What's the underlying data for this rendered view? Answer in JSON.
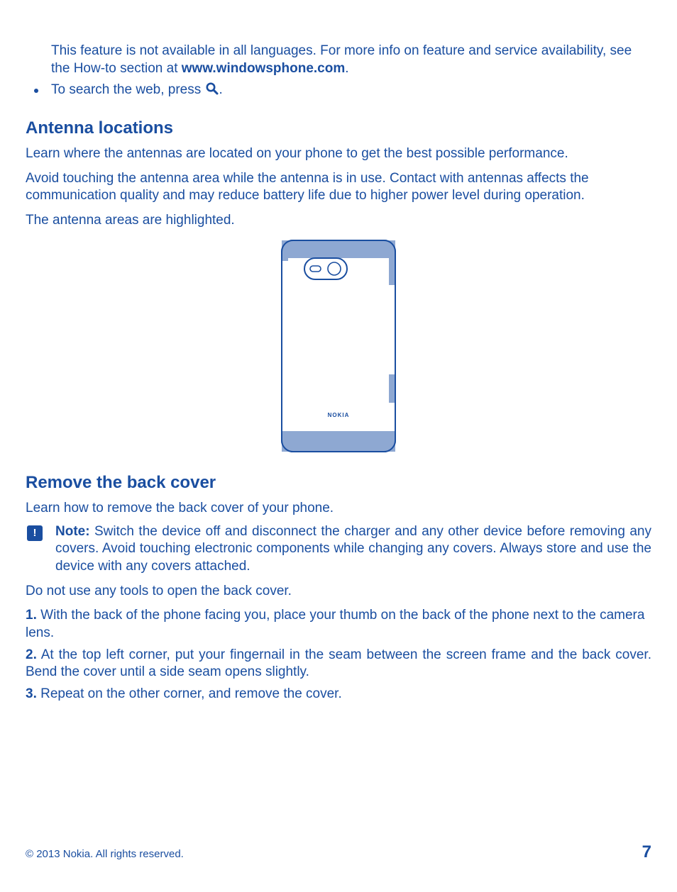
{
  "intro": {
    "p1a": "This feature is not available in all languages. For more info on feature and service availability, see the How-to section at ",
    "p1b_bold": "www.windowsphone.com",
    "p1c": ".",
    "bullet_a": "To search the web, press ",
    "bullet_c": "."
  },
  "antenna": {
    "heading": "Antenna locations",
    "p1": "Learn where the antennas are located on your phone to get the best possible performance.",
    "p2": "Avoid touching the antenna area while the antenna is in use. Contact with antennas affects the communication quality and may reduce battery life due to higher power level during operation.",
    "p3": "The antenna areas are highlighted.",
    "phone_brand": "NOKIA"
  },
  "backcover": {
    "heading": "Remove the back cover",
    "p1": "Learn how to remove the back cover of your phone.",
    "note_label": "Note:",
    "note_text": " Switch the device off and disconnect the charger and any other device before removing any covers. Avoid touching electronic components while changing any covers. Always store and use the device with any covers attached.",
    "p2": "Do not use any tools to open the back cover.",
    "step1_num": "1.",
    "step1_text": " With the back of the phone facing you, place your thumb on the back of the phone next to the camera lens.",
    "step2_num": "2.",
    "step2_text": " At the top left corner, put your fingernail in the seam between the screen frame and the back cover. Bend the cover until a side seam opens slightly.",
    "step3_num": "3.",
    "step3_text": " Repeat on the other corner, and remove the cover."
  },
  "footer": {
    "copyright": "© 2013 Nokia. All rights reserved.",
    "page": "7"
  }
}
